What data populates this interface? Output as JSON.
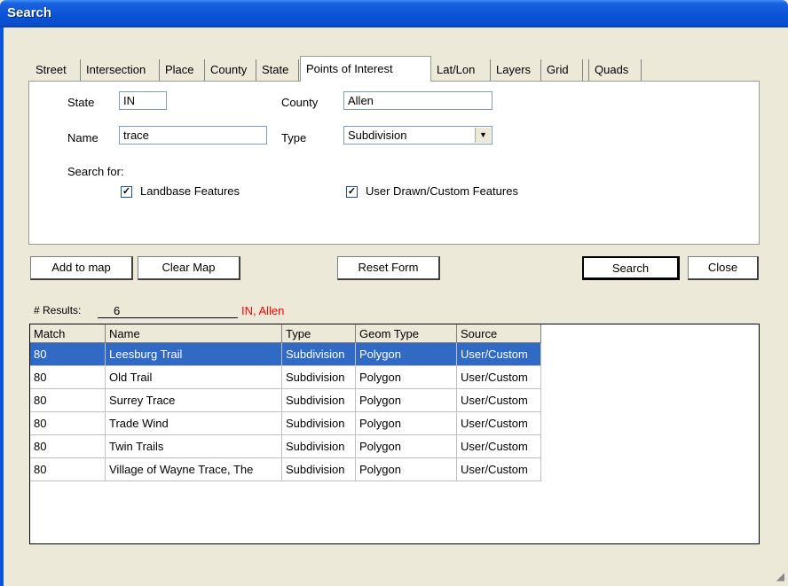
{
  "window": {
    "title": "Search"
  },
  "tabs": [
    {
      "label": "Street"
    },
    {
      "label": "Intersection"
    },
    {
      "label": "Place"
    },
    {
      "label": "County"
    },
    {
      "label": "State"
    },
    {
      "label": "Points of Interest",
      "active": true
    },
    {
      "label": "Lat/Lon"
    },
    {
      "label": "Layers"
    },
    {
      "label": "Grid"
    },
    {
      "label": "Quads"
    }
  ],
  "form": {
    "state_label": "State",
    "state_value": "IN",
    "county_label": "County",
    "county_value": "Allen",
    "name_label": "Name",
    "name_value": "trace",
    "type_label": "Type",
    "type_value": "Subdivision",
    "search_for_label": "Search for:",
    "landbase_label": "Landbase Features",
    "landbase_checked": true,
    "user_drawn_label": "User Drawn/Custom Features",
    "user_drawn_checked": true
  },
  "buttons": {
    "add_to_map": "Add to map",
    "clear_map": "Clear Map",
    "reset_form": "Reset Form",
    "search": "Search",
    "close": "Close"
  },
  "results": {
    "count_label": "# Results:",
    "count_value": "6",
    "location_text": "IN, Allen",
    "location_color": "#ff0000",
    "columns": [
      "Match",
      "Name",
      "Type",
      "Geom Type",
      "Source"
    ],
    "rows": [
      {
        "match": "80",
        "name": "Leesburg Trail",
        "type": "Subdivision",
        "geom": "Polygon",
        "source": "User/Custom",
        "selected": true
      },
      {
        "match": "80",
        "name": "Old Trail",
        "type": "Subdivision",
        "geom": "Polygon",
        "source": "User/Custom"
      },
      {
        "match": "80",
        "name": "Surrey Trace",
        "type": "Subdivision",
        "geom": "Polygon",
        "source": "User/Custom"
      },
      {
        "match": "80",
        "name": "Trade Wind",
        "type": "Subdivision",
        "geom": "Polygon",
        "source": "User/Custom"
      },
      {
        "match": "80",
        "name": "Twin Trails",
        "type": "Subdivision",
        "geom": "Polygon",
        "source": "User/Custom"
      },
      {
        "match": "80",
        "name": "Village of Wayne Trace, The",
        "type": "Subdivision",
        "geom": "Polygon",
        "source": "User/Custom"
      }
    ]
  },
  "colors": {
    "selection": "#316ac5",
    "titlebar": "#0b55d8"
  }
}
